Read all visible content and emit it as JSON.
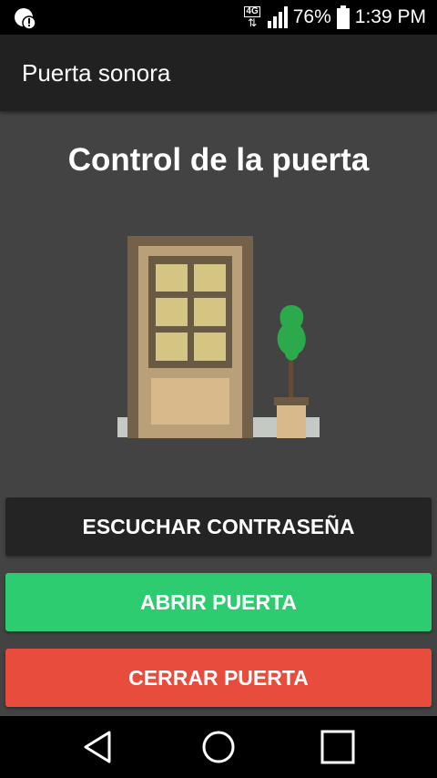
{
  "status_bar": {
    "network_type": "4G",
    "battery_percent": "76%",
    "time": "1:39 PM",
    "icons": [
      "notification-alert-icon",
      "network-4g-icon",
      "signal-icon",
      "battery-icon"
    ]
  },
  "app_bar": {
    "title": "Puerta sonora"
  },
  "main": {
    "heading": "Control de la puerta",
    "illustration": "door-with-plant"
  },
  "buttons": {
    "listen": "ESCUCHAR CONTRASEÑA",
    "open": "ABRIR PUERTA",
    "close": "CERRAR PUERTA"
  },
  "colors": {
    "background": "#434343",
    "app_bar": "#212121",
    "listen_button": "#242424",
    "open_button": "#2ecc71",
    "close_button": "#e74c3c"
  },
  "nav_bar": {
    "icons": [
      "back-icon",
      "home-icon",
      "recents-icon"
    ]
  }
}
